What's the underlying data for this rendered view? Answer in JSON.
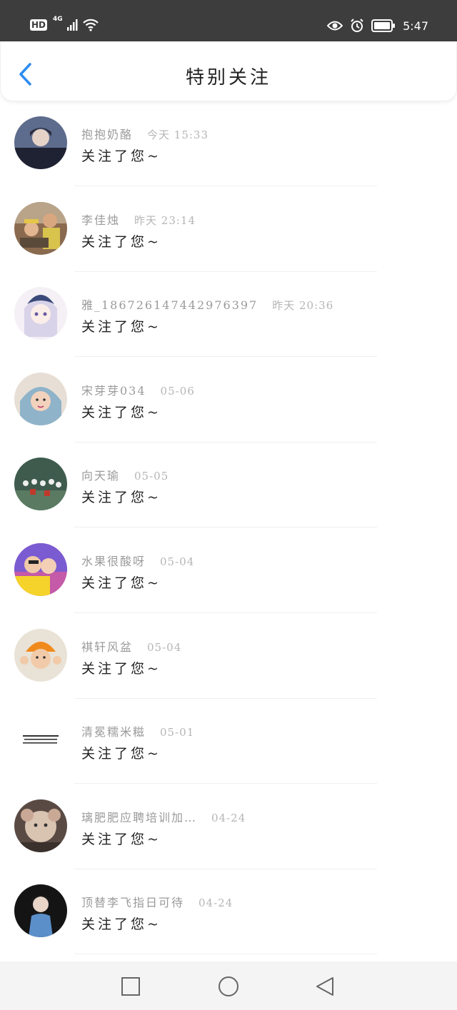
{
  "status_bar": {
    "hd": "HD",
    "network": "4G",
    "time": "5:47",
    "icons": [
      "signal-icon",
      "wifi-icon",
      "eye-icon",
      "alarm-icon",
      "battery-icon"
    ]
  },
  "header": {
    "title": "特别关注",
    "back_icon": "chevron-left-icon",
    "accent_color": "#2d8cf0"
  },
  "list": {
    "items": [
      {
        "name": "抱抱奶酪",
        "time": "今天 15:33",
        "message": "关注了您~"
      },
      {
        "name": "李佳烛",
        "time": "昨天 23:14",
        "message": "关注了您~"
      },
      {
        "name": "雅_18672614744​2976397",
        "time": "昨天 20:36",
        "message": "关注了您~"
      },
      {
        "name": "宋芽芽034",
        "time": "05-06",
        "message": "关注了您~"
      },
      {
        "name": "向天瑜",
        "time": "05-05",
        "message": "关注了您~"
      },
      {
        "name": "水果很酸呀",
        "time": "05-04",
        "message": "关注了您~"
      },
      {
        "name": "褀轩风盆",
        "time": "05-04",
        "message": "关注了您~"
      },
      {
        "name": "清冕糯米糍",
        "time": "05-01",
        "message": "关注了您~"
      },
      {
        "name": "璃肥肥应聘培训加…",
        "time": "04-24",
        "message": "关注了您~"
      },
      {
        "name": "顶替李飞指日可待",
        "time": "04-24",
        "message": "关注了您~"
      }
    ]
  },
  "nav_bar": {
    "icons": [
      "square-recents-icon",
      "circle-home-icon",
      "triangle-back-icon"
    ]
  }
}
